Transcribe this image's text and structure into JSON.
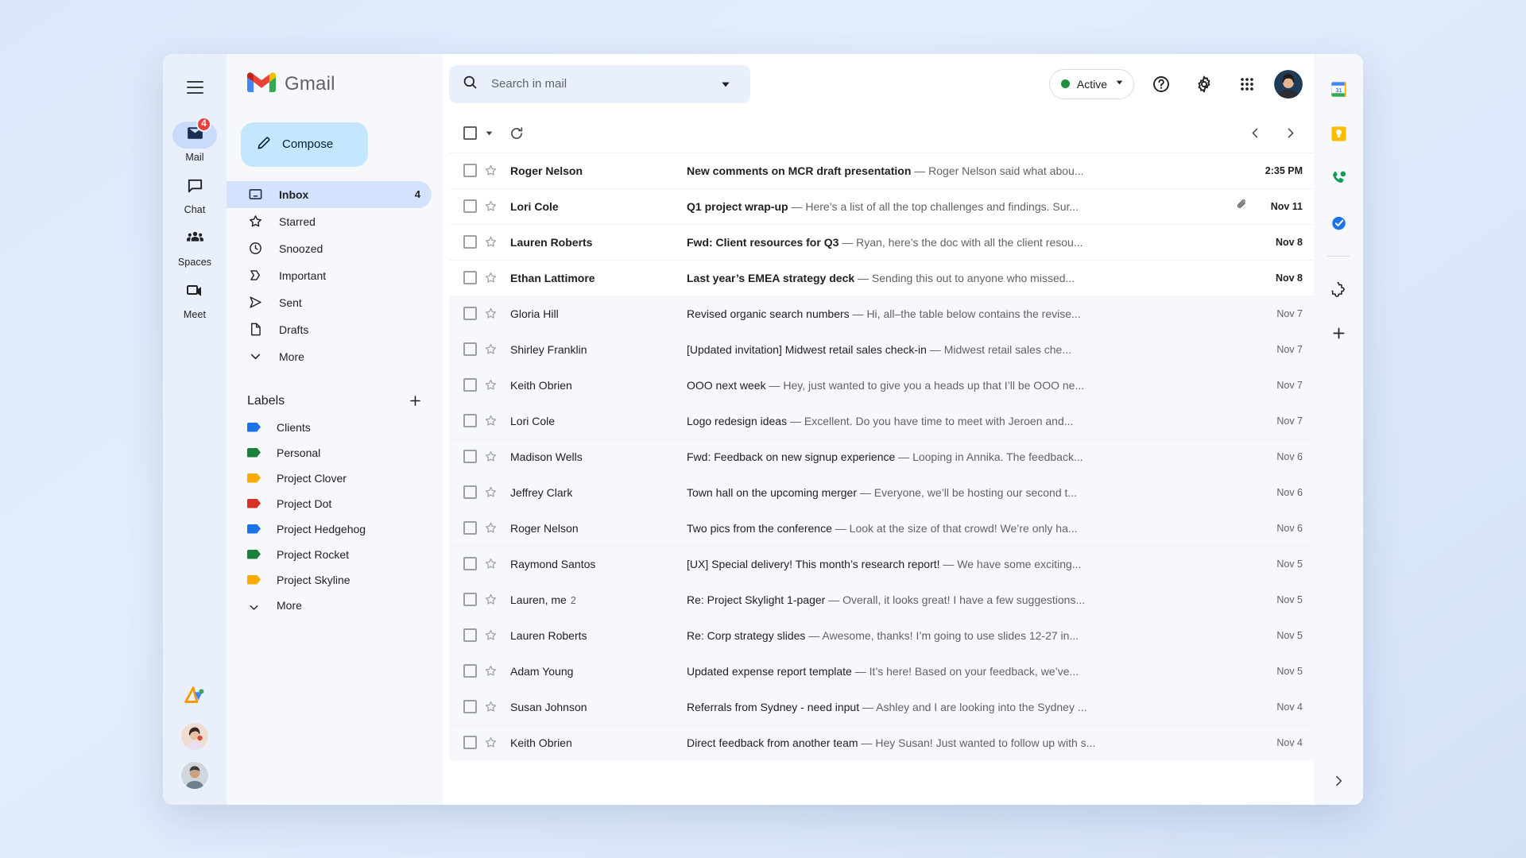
{
  "app": {
    "brand": "Gmail"
  },
  "rail": {
    "menu_icon": "hamburger-icon",
    "items": [
      {
        "label": "Mail",
        "icon": "mail-icon",
        "badge": "4",
        "active": true
      },
      {
        "label": "Chat",
        "icon": "chat-bubble-icon",
        "badge": "",
        "active": false
      },
      {
        "label": "Spaces",
        "icon": "spaces-people-icon",
        "badge": "",
        "active": false
      },
      {
        "label": "Meet",
        "icon": "video-camera-icon",
        "badge": "",
        "active": false
      }
    ]
  },
  "sidebar": {
    "compose_label": "Compose",
    "compose_icon": "pencil-icon",
    "nav": [
      {
        "label": "Inbox",
        "icon": "inbox-icon",
        "count": "4",
        "active": true
      },
      {
        "label": "Starred",
        "icon": "star-icon",
        "count": "",
        "active": false
      },
      {
        "label": "Snoozed",
        "icon": "clock-icon",
        "count": "",
        "active": false
      },
      {
        "label": "Important",
        "icon": "important-chevron-icon",
        "count": "",
        "active": false
      },
      {
        "label": "Sent",
        "icon": "send-icon",
        "count": "",
        "active": false
      },
      {
        "label": "Drafts",
        "icon": "document-icon",
        "count": "",
        "active": false
      },
      {
        "label": "More",
        "icon": "chevron-down-icon",
        "count": "",
        "active": false
      }
    ],
    "labels_title": "Labels",
    "labels_add_icon": "plus-icon",
    "labels": [
      {
        "label": "Clients",
        "color": "#1a73e8"
      },
      {
        "label": "Personal",
        "color": "#188038"
      },
      {
        "label": "Project Clover",
        "color": "#f9ab00"
      },
      {
        "label": "Project Dot",
        "color": "#d93025"
      },
      {
        "label": "Project Hedgehog",
        "color": "#1a73e8"
      },
      {
        "label": "Project Rocket",
        "color": "#188038"
      },
      {
        "label": "Project Skyline",
        "color": "#f9ab00"
      }
    ],
    "labels_more": "More"
  },
  "search": {
    "placeholder": "Search in mail",
    "value": "",
    "icon": "search-icon",
    "options_icon": "chevron-down-icon"
  },
  "topbar": {
    "status_label": "Active",
    "status_color": "#1e8e3e",
    "status_caret_icon": "chevron-down-icon",
    "help_icon": "help-circle-icon",
    "settings_icon": "gear-icon",
    "apps_icon": "apps-grid-icon",
    "avatar_name": "account-avatar"
  },
  "list_toolbar": {
    "select_all_icon": "checkbox-icon",
    "select_caret_icon": "chevron-down-icon",
    "refresh_icon": "refresh-icon",
    "prev_icon": "chevron-left-icon",
    "next_icon": "chevron-right-icon"
  },
  "emails": [
    {
      "sender": "Roger Nelson",
      "count": "",
      "subject": "New comments on MCR draft presentation",
      "snippet": "Roger Nelson said what abou...",
      "date": "2:35 PM",
      "unread": true,
      "attachment": false
    },
    {
      "sender": "Lori Cole",
      "count": "",
      "subject": "Q1 project wrap-up",
      "snippet": "Here’s a list of all the top challenges and findings. Sur...",
      "date": "Nov 11",
      "unread": true,
      "attachment": true
    },
    {
      "sender": "Lauren Roberts",
      "count": "",
      "subject": "Fwd: Client resources for Q3",
      "snippet": "Ryan, here’s the doc with all the client resou...",
      "date": "Nov 8",
      "unread": true,
      "attachment": false
    },
    {
      "sender": "Ethan Lattimore",
      "count": "",
      "subject": "Last year’s EMEA strategy deck",
      "snippet": "Sending this out to anyone who missed...",
      "date": "Nov 8",
      "unread": true,
      "attachment": false
    },
    {
      "sender": "Gloria Hill",
      "count": "",
      "subject": "Revised organic search numbers",
      "snippet": "Hi, all–the table below contains the revise...",
      "date": "Nov 7",
      "unread": false,
      "attachment": false
    },
    {
      "sender": "Shirley Franklin",
      "count": "",
      "subject": "[Updated invitation] Midwest retail sales check-in",
      "snippet": "Midwest retail sales che...",
      "date": "Nov 7",
      "unread": false,
      "attachment": false
    },
    {
      "sender": "Keith Obrien",
      "count": "",
      "subject": "OOO next week",
      "snippet": "Hey, just wanted to give you a heads up that I’ll be OOO ne...",
      "date": "Nov 7",
      "unread": false,
      "attachment": false
    },
    {
      "sender": "Lori Cole",
      "count": "",
      "subject": "Logo redesign ideas",
      "snippet": "Excellent. Do you have time to meet with Jeroen and...",
      "date": "Nov 7",
      "unread": false,
      "attachment": false
    },
    {
      "sender": "Madison Wells",
      "count": "",
      "subject": "Fwd: Feedback on new signup experience",
      "snippet": "Looping in Annika. The feedback...",
      "date": "Nov 6",
      "unread": false,
      "attachment": false
    },
    {
      "sender": "Jeffrey Clark",
      "count": "",
      "subject": "Town hall on the upcoming merger",
      "snippet": "Everyone, we’ll be hosting our second t...",
      "date": "Nov 6",
      "unread": false,
      "attachment": false
    },
    {
      "sender": "Roger Nelson",
      "count": "",
      "subject": "Two pics from the conference",
      "snippet": "Look at the size of that crowd! We’re only ha...",
      "date": "Nov 6",
      "unread": false,
      "attachment": false
    },
    {
      "sender": "Raymond Santos",
      "count": "",
      "subject": "[UX] Special delivery! This month’s research report!",
      "snippet": "We have some exciting...",
      "date": "Nov 5",
      "unread": false,
      "attachment": false
    },
    {
      "sender": "Lauren, me",
      "count": "2",
      "subject": "Re: Project Skylight 1-pager",
      "snippet": "Overall, it looks great! I have a few suggestions...",
      "date": "Nov 5",
      "unread": false,
      "attachment": false
    },
    {
      "sender": "Lauren Roberts",
      "count": "",
      "subject": "Re: Corp strategy slides",
      "snippet": "Awesome, thanks! I’m going to use slides 12-27 in...",
      "date": "Nov 5",
      "unread": false,
      "attachment": false
    },
    {
      "sender": "Adam Young",
      "count": "",
      "subject": "Updated expense report template",
      "snippet": "It’s here! Based on your feedback, we’ve...",
      "date": "Nov 5",
      "unread": false,
      "attachment": false
    },
    {
      "sender": "Susan Johnson",
      "count": "",
      "subject": "Referrals from Sydney - need input",
      "snippet": "Ashley and I are looking into the Sydney ...",
      "date": "Nov 4",
      "unread": false,
      "attachment": false
    },
    {
      "sender": "Keith Obrien",
      "count": "",
      "subject": "Direct feedback from another team",
      "snippet": "Hey Susan! Just wanted to follow up with s...",
      "date": "Nov 4",
      "unread": false,
      "attachment": false
    }
  ],
  "right_rail": {
    "items": [
      {
        "icon": "google-calendar-icon"
      },
      {
        "icon": "google-keep-icon"
      },
      {
        "icon": "google-contacts-phone-icon"
      },
      {
        "icon": "google-tasks-icon"
      }
    ],
    "addon_icon": "puzzle-piece-icon",
    "add_icon": "plus-icon",
    "expand_icon": "chevron-right-icon"
  }
}
